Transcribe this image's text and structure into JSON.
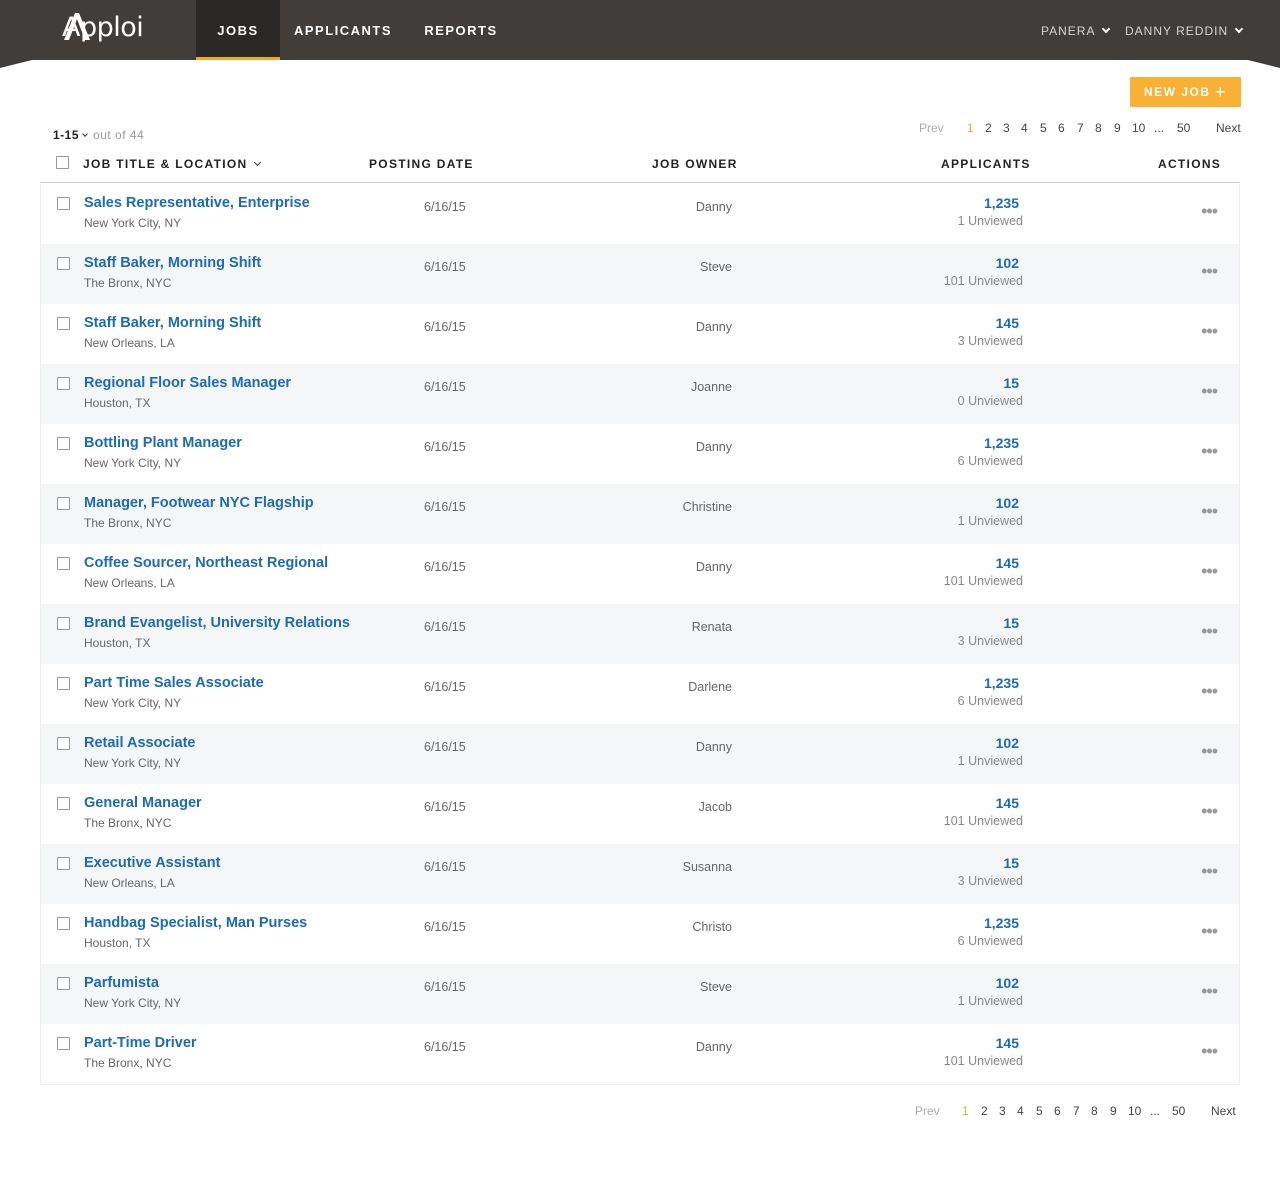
{
  "header": {
    "logo": "Apploi",
    "nav": {
      "jobs": "JOBS",
      "applicants": "APPLICANTS",
      "reports": "REPORTS"
    },
    "company": "PANERA",
    "user": "DANNY REDDIN",
    "accent_color": "#f5a623",
    "bar_color": "#403d3b"
  },
  "toolbar": {
    "new_job_label": "NEW JOB",
    "new_job_icon": "+"
  },
  "range": {
    "current": "1-15",
    "of_label": "out of 44"
  },
  "pagination": {
    "prev": "Prev",
    "pages": [
      "1",
      "2",
      "3",
      "4",
      "5",
      "6",
      "7",
      "8",
      "9",
      "10"
    ],
    "ellipsis": "...",
    "last": "50",
    "next": "Next",
    "current_page": "1"
  },
  "table": {
    "columns": {
      "title": "JOB TITLE & LOCATION",
      "date": "POSTING DATE",
      "owner": "JOB OWNER",
      "applicants": "APPLICANTS",
      "actions": "ACTIONS"
    },
    "actions_icon": "•••",
    "rows": [
      {
        "title": "Sales Representative, Enterprise",
        "location": "New York City, NY",
        "date": "6/16/15",
        "owner": "Danny",
        "applicants": "1,235",
        "unviewed": "1 Unviewed"
      },
      {
        "title": "Staff Baker, Morning Shift",
        "location": "The Bronx, NYC",
        "date": "6/16/15",
        "owner": "Steve",
        "applicants": "102",
        "unviewed": "101 Unviewed"
      },
      {
        "title": "Staff Baker, Morning Shift",
        "location": "New Orleans, LA",
        "date": "6/16/15",
        "owner": "Danny",
        "applicants": "145",
        "unviewed": "3 Unviewed"
      },
      {
        "title": "Regional Floor Sales Manager",
        "location": "Houston, TX",
        "date": "6/16/15",
        "owner": "Joanne",
        "applicants": "15",
        "unviewed": "0 Unviewed"
      },
      {
        "title": "Bottling Plant Manager",
        "location": "New York City, NY",
        "date": "6/16/15",
        "owner": "Danny",
        "applicants": "1,235",
        "unviewed": "6 Unviewed"
      },
      {
        "title": "Manager, Footwear NYC Flagship",
        "location": "The Bronx, NYC",
        "date": "6/16/15",
        "owner": "Christine",
        "applicants": "102",
        "unviewed": "1 Unviewed"
      },
      {
        "title": "Coffee Sourcer, Northeast Regional",
        "location": "New Orleans, LA",
        "date": "6/16/15",
        "owner": "Danny",
        "applicants": "145",
        "unviewed": "101 Unviewed"
      },
      {
        "title": "Brand Evangelist, University Relations",
        "location": "Houston, TX",
        "date": "6/16/15",
        "owner": "Renata",
        "applicants": "15",
        "unviewed": "3 Unviewed"
      },
      {
        "title": "Part Time Sales Associate",
        "location": "New York City, NY",
        "date": "6/16/15",
        "owner": "Darlene",
        "applicants": "1,235",
        "unviewed": "6 Unviewed"
      },
      {
        "title": "Retail Associate",
        "location": "New York City, NY",
        "date": "6/16/15",
        "owner": "Danny",
        "applicants": "102",
        "unviewed": "1 Unviewed"
      },
      {
        "title": "General Manager",
        "location": "The Bronx, NYC",
        "date": "6/16/15",
        "owner": "Jacob",
        "applicants": "145",
        "unviewed": "101 Unviewed"
      },
      {
        "title": "Executive Assistant",
        "location": "New Orleans, LA",
        "date": "6/16/15",
        "owner": "Susanna",
        "applicants": "15",
        "unviewed": "3 Unviewed"
      },
      {
        "title": "Handbag Specialist, Man Purses",
        "location": "Houston, TX",
        "date": "6/16/15",
        "owner": "Christo",
        "applicants": "1,235",
        "unviewed": "6 Unviewed"
      },
      {
        "title": "Parfumista",
        "location": "New York City, NY",
        "date": "6/16/15",
        "owner": "Steve",
        "applicants": "102",
        "unviewed": "1 Unviewed"
      },
      {
        "title": "Part-Time Driver",
        "location": "The Bronx, NYC",
        "date": "6/16/15",
        "owner": "Danny",
        "applicants": "145",
        "unviewed": "101 Unviewed"
      }
    ]
  }
}
